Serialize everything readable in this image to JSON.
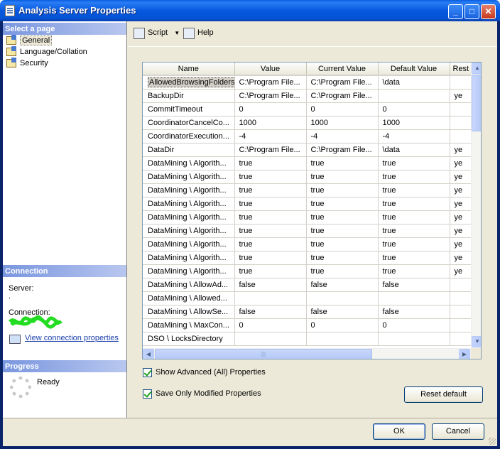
{
  "window": {
    "title": "Analysis Server Properties",
    "minimize": "_",
    "maximize": "□",
    "close": "✕"
  },
  "left_panel": {
    "select_page_header": "Select a page",
    "pages": [
      {
        "label": "General",
        "icon": "page-icon",
        "selected": true
      },
      {
        "label": "Language/Collation",
        "icon": "page-icon",
        "selected": false
      },
      {
        "label": "Security",
        "icon": "page-icon",
        "selected": false
      }
    ],
    "connection_header": "Connection",
    "server_label": "Server:",
    "server_value": ".",
    "connection_label": "Connection:",
    "view_connection_link": "View connection properties",
    "progress_header": "Progress",
    "progress_status": "Ready"
  },
  "toolbar": {
    "script_label": "Script",
    "help_label": "Help"
  },
  "grid": {
    "columns": [
      "Name",
      "Value",
      "Current Value",
      "Default Value",
      "Rest"
    ],
    "rows": [
      {
        "name": "AllowedBrowsingFolders",
        "value": "C:\\Program File...",
        "current": "C:\\Program File...",
        "default": "\\data",
        "restart": ""
      },
      {
        "name": "BackupDir",
        "value": "C:\\Program File...",
        "current": "C:\\Program File...",
        "default": "",
        "restart": "ye"
      },
      {
        "name": "CommitTimeout",
        "value": "0",
        "current": "0",
        "default": "0",
        "restart": ""
      },
      {
        "name": "CoordinatorCancelCo...",
        "value": "1000",
        "current": "1000",
        "default": "1000",
        "restart": ""
      },
      {
        "name": "CoordinatorExecution...",
        "value": "-4",
        "current": "-4",
        "default": "-4",
        "restart": ""
      },
      {
        "name": "DataDir",
        "value": "C:\\Program File...",
        "current": "C:\\Program File...",
        "default": "\\data",
        "restart": "ye"
      },
      {
        "name": "DataMining \\ Algorith...",
        "value": "true",
        "current": "true",
        "default": "true",
        "restart": "ye"
      },
      {
        "name": "DataMining \\ Algorith...",
        "value": "true",
        "current": "true",
        "default": "true",
        "restart": "ye"
      },
      {
        "name": "DataMining \\ Algorith...",
        "value": "true",
        "current": "true",
        "default": "true",
        "restart": "ye"
      },
      {
        "name": "DataMining \\ Algorith...",
        "value": "true",
        "current": "true",
        "default": "true",
        "restart": "ye"
      },
      {
        "name": "DataMining \\ Algorith...",
        "value": "true",
        "current": "true",
        "default": "true",
        "restart": "ye"
      },
      {
        "name": "DataMining \\ Algorith...",
        "value": "true",
        "current": "true",
        "default": "true",
        "restart": "ye"
      },
      {
        "name": "DataMining \\ Algorith...",
        "value": "true",
        "current": "true",
        "default": "true",
        "restart": "ye"
      },
      {
        "name": "DataMining \\ Algorith...",
        "value": "true",
        "current": "true",
        "default": "true",
        "restart": "ye"
      },
      {
        "name": "DataMining \\ Algorith...",
        "value": "true",
        "current": "true",
        "default": "true",
        "restart": "ye"
      },
      {
        "name": "DataMining \\ AllowAd...",
        "value": "false",
        "current": "false",
        "default": "false",
        "restart": ""
      },
      {
        "name": "DataMining \\ Allowed...",
        "value": "",
        "current": "",
        "default": "",
        "restart": ""
      },
      {
        "name": "DataMining \\ AllowSe...",
        "value": "false",
        "current": "false",
        "default": "false",
        "restart": ""
      },
      {
        "name": "DataMining \\ MaxCon...",
        "value": "0",
        "current": "0",
        "default": "0",
        "restart": ""
      },
      {
        "name": "DSO \\ LocksDirectory",
        "value": "",
        "current": "",
        "default": "",
        "restart": ""
      }
    ]
  },
  "options": {
    "show_advanced": "Show Advanced (All) Properties",
    "save_only_modified": "Save Only Modified Properties",
    "reset_default": "Reset default"
  },
  "footer": {
    "ok": "OK",
    "cancel": "Cancel"
  }
}
